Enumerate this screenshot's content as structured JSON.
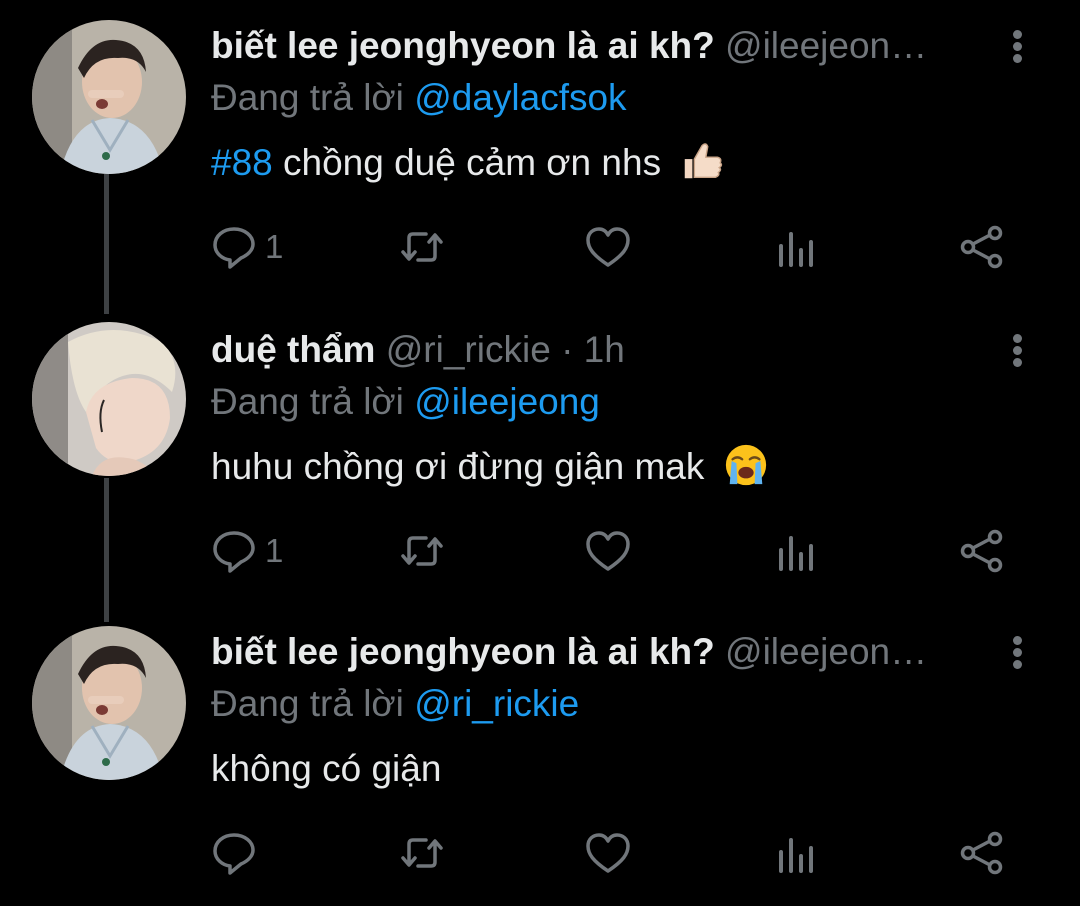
{
  "tweets": [
    {
      "name": "biết lee jeonghyeon là ai kh?",
      "handle": "@ileejeon…",
      "time": "",
      "reply_prefix": "Đang trả lời",
      "reply_to": "@daylacfsok",
      "hashtag": "#88",
      "text": "chồng duệ cảm ơn nhs",
      "emoji": "thumbs-up",
      "reply_count": "1",
      "avatar": "boy-pointing-cheek"
    },
    {
      "name": "duệ thẩm",
      "handle": "@ri_rickie",
      "time": "· 1h",
      "reply_prefix": "Đang trả lời",
      "reply_to": "@ileejeong",
      "hashtag": "",
      "text": "huhu chồng ơi đừng giận mak",
      "emoji": "loudly-crying-face",
      "reply_count": "1",
      "avatar": "blonde-profile-tattoo"
    },
    {
      "name": "biết lee jeonghyeon là ai kh?",
      "handle": "@ileejeon…",
      "time": "",
      "reply_prefix": "Đang trả lời",
      "reply_to": "@ri_rickie",
      "hashtag": "",
      "text": "không có giận",
      "emoji": "",
      "reply_count": "",
      "avatar": "boy-pointing-cheek"
    }
  ],
  "colors": {
    "background": "#000000",
    "primary_text": "#e7e9ea",
    "secondary_text": "#71767b",
    "accent": "#1d9bf0",
    "thread_line": "#3e4144"
  },
  "icons": [
    "reply-icon",
    "retweet-icon",
    "like-icon",
    "analytics-icon",
    "share-icon",
    "more-icon"
  ]
}
